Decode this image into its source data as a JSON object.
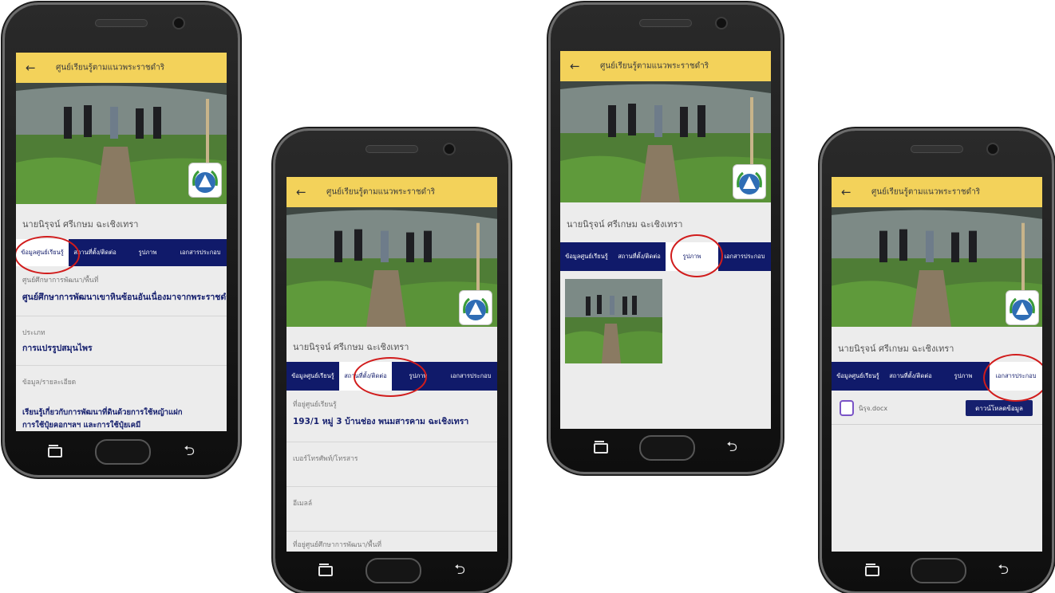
{
  "app": {
    "title": "ศูนย์เรียนรู้ตามแนวพระราชดำริ",
    "back_icon": "arrow-left-icon",
    "person_name": "นายนิรุจน์ ศรีเกษม  ฉะเชิงเทรา"
  },
  "tabs": [
    "ข้อมูลศูนย์เรียนรู้",
    "สถานที่ตั้ง/ติดต่อ",
    "รูปภาพ",
    "เอกสารประกอบ"
  ],
  "screens": [
    {
      "active_tab": 0,
      "fields": [
        {
          "label": "ศูนย์ศึกษาการพัฒนา/พื้นที่",
          "value": "ศูนย์ศึกษาการพัฒนาเขาหินซ้อนอันเนื่องมาจากพระราชดำริ"
        },
        {
          "label": "ประเภท",
          "value": "การแปรรูปสมุนไพร"
        },
        {
          "label": "ข้อมูล/รายละเอียด",
          "value": "เรียนรู้เกี่ยวกับการพัฒนาที่ดินด้วยการใช้หญ้าแฝก",
          "value2": "การใช้ปุ๋ยคอกฯลฯ และการใช้ปุ๋ยเคมี"
        }
      ]
    },
    {
      "active_tab": 1,
      "fields": [
        {
          "label": "ที่อยู่ศูนย์เรียนรู้",
          "value": "193/1 หมู่ 3   บ้านช่อง พนมสารคาม ฉะเชิงเทรา"
        },
        {
          "label": "เบอร์โทรศัพท์/โทรสาร",
          "value": ""
        },
        {
          "label": "อีเมลล์",
          "value": ""
        },
        {
          "label": "ที่อยู่ศูนย์ศึกษาการพัฒนา/พื้นที่",
          "value": ""
        }
      ]
    },
    {
      "active_tab": 2,
      "fields": []
    },
    {
      "active_tab": 3,
      "document": {
        "icon": "document-icon",
        "file_name": "นิรุจ.docx",
        "download_label": "ดาวน์โหลดข้อมูล"
      }
    }
  ],
  "colors": {
    "appbar": "#f3d25a",
    "tabbar": "#101a6a",
    "highlight_circle": "#d11c1c"
  }
}
